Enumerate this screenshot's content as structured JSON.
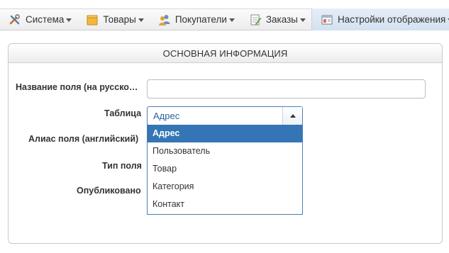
{
  "menu": {
    "items": [
      {
        "label": "Система",
        "icon": "tools-icon"
      },
      {
        "label": "Товары",
        "icon": "box-icon"
      },
      {
        "label": "Покупатели",
        "icon": "users-icon"
      },
      {
        "label": "Заказы",
        "icon": "notepad-icon"
      },
      {
        "label": "Настройки отображения",
        "icon": "window-settings-icon"
      }
    ]
  },
  "panel": {
    "title": "ОСНОВНАЯ ИНФОРМАЦИЯ"
  },
  "form": {
    "name_label": "Название поля (на русско…",
    "name_value": "",
    "table_label": "Таблица",
    "table_value": "Адрес",
    "alias_label": "Алиас поля (английский)",
    "type_label": "Тип поля",
    "published_label": "Опубликовано"
  },
  "dropdown": {
    "options": [
      "Адрес",
      "Пользователь",
      "Товар",
      "Категория",
      "Контакт"
    ],
    "selected": "Адрес"
  },
  "colors": {
    "accent": "#3575b5",
    "border_focus": "#4a7fb5"
  }
}
